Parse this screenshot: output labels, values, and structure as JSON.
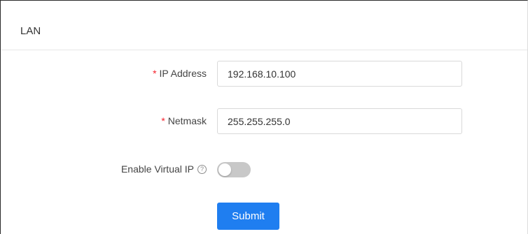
{
  "card": {
    "title": "LAN"
  },
  "form": {
    "ip_address": {
      "required_mark": "*",
      "label": "IP Address",
      "value": "192.168.10.100"
    },
    "netmask": {
      "required_mark": "*",
      "label": "Netmask",
      "value": "255.255.255.0"
    },
    "virtual_ip": {
      "label": "Enable Virtual IP",
      "help_icon": "question-circle-icon",
      "help_glyph": "?",
      "enabled": false
    },
    "submit_label": "Submit"
  },
  "colors": {
    "primary": "#1f7ef0",
    "required": "#f5222d",
    "switch_off": "#c8c8c8"
  }
}
